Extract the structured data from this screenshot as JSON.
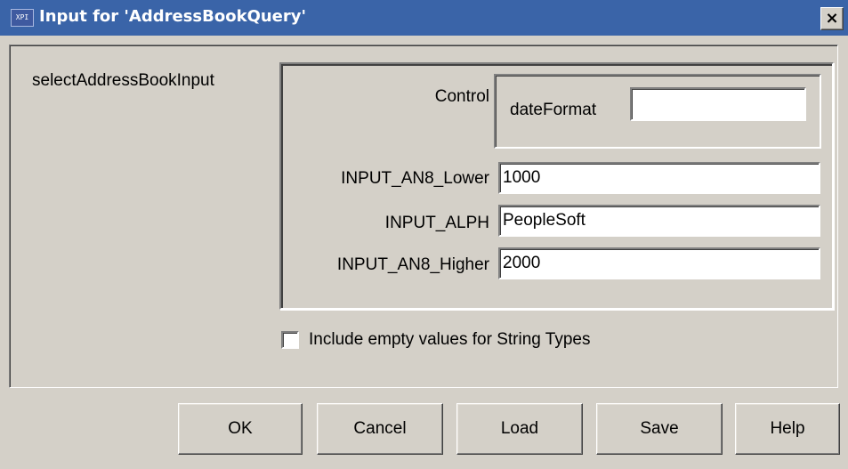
{
  "window": {
    "icon": "xpi-app-icon",
    "icon_text": "XPI",
    "title": "Input for 'AddressBookQuery'",
    "close_label": "×"
  },
  "form": {
    "param_label": "selectAddressBookInput",
    "control_label": "Control",
    "date_format_label": "dateFormat",
    "date_format_value": "",
    "fields": [
      {
        "label": "INPUT_AN8_Lower",
        "value": "1000"
      },
      {
        "label": "INPUT_ALPH",
        "value": "PeopleSoft"
      },
      {
        "label": "INPUT_AN8_Higher",
        "value": "2000"
      }
    ],
    "include_empty_label": "Include empty values for String Types",
    "include_empty_checked": false
  },
  "buttons": {
    "ok": "OK",
    "cancel": "Cancel",
    "load": "Load",
    "save": "Save",
    "help": "Help"
  },
  "colors": {
    "titlebar": "#3a64a8",
    "dialog_bg": "#d4d0c8"
  }
}
